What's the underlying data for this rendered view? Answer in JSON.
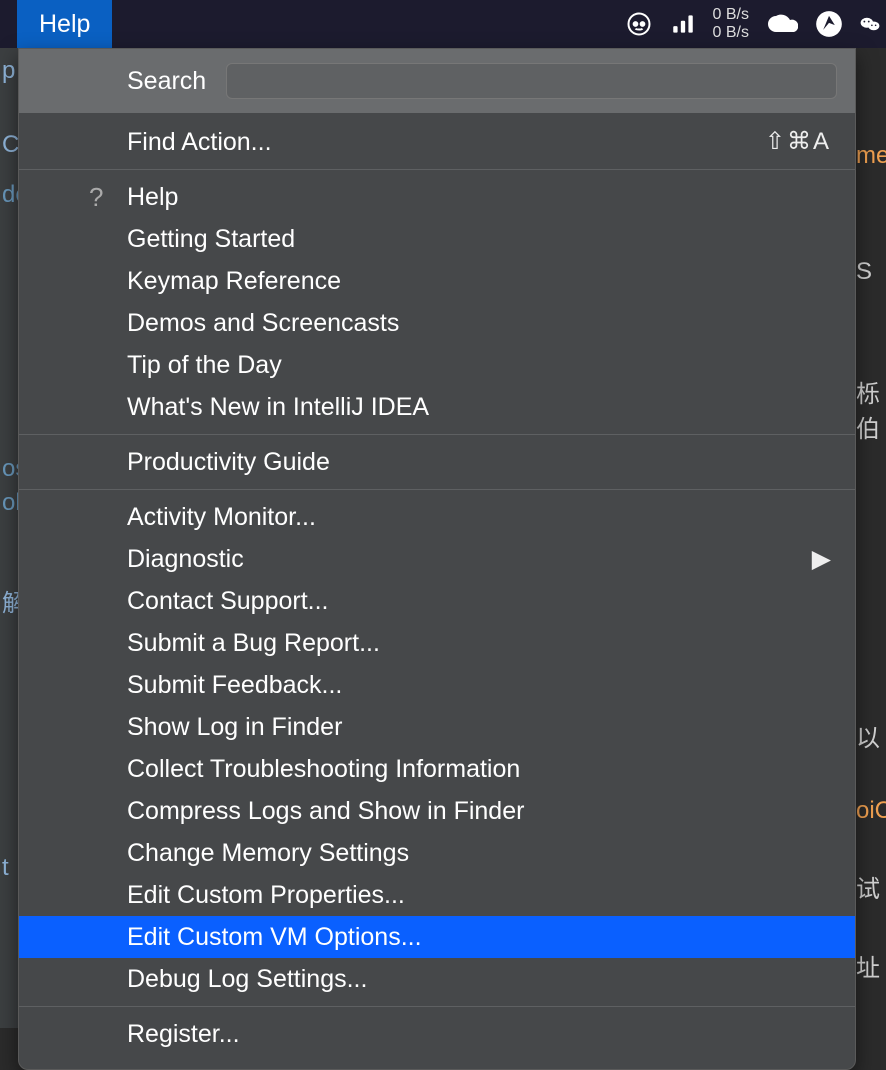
{
  "topbar": {
    "help_label": "Help",
    "net_up": "0 B/s",
    "net_down": "0 B/s"
  },
  "menu": {
    "search_label": "Search",
    "find_action": {
      "label": "Find Action...",
      "shortcut": "⇧⌘A"
    },
    "group1": [
      {
        "label": "Help",
        "has_icon": true
      },
      {
        "label": "Getting Started"
      },
      {
        "label": "Keymap Reference"
      },
      {
        "label": "Demos and Screencasts"
      },
      {
        "label": "Tip of the Day"
      },
      {
        "label": "What's New in IntelliJ IDEA"
      }
    ],
    "group2": [
      {
        "label": "Productivity Guide"
      }
    ],
    "group3": [
      {
        "label": "Activity Monitor..."
      },
      {
        "label": "Diagnostic",
        "submenu": true
      },
      {
        "label": "Contact Support..."
      },
      {
        "label": "Submit a Bug Report..."
      },
      {
        "label": "Submit Feedback..."
      },
      {
        "label": "Show Log in Finder"
      },
      {
        "label": "Collect Troubleshooting Information"
      },
      {
        "label": "Compress Logs and Show in Finder"
      },
      {
        "label": "Change Memory Settings"
      },
      {
        "label": "Edit Custom Properties..."
      },
      {
        "label": "Edit Custom VM Options...",
        "highlight": true
      },
      {
        "label": "Debug Log Settings..."
      }
    ],
    "group4": [
      {
        "label": "Register..."
      }
    ]
  },
  "bg_left": {
    "l1": "p",
    "l2": "C",
    "l3": "de",
    "l4": "os",
    "l5": "ob",
    "l6": "解",
    "l7": "t"
  },
  "bg_right": {
    "r1": "me",
    "r2": "S",
    "r3": "栎伯",
    "r4": "以",
    "r5": "oiC",
    "r6": "试",
    "r7": "址"
  }
}
